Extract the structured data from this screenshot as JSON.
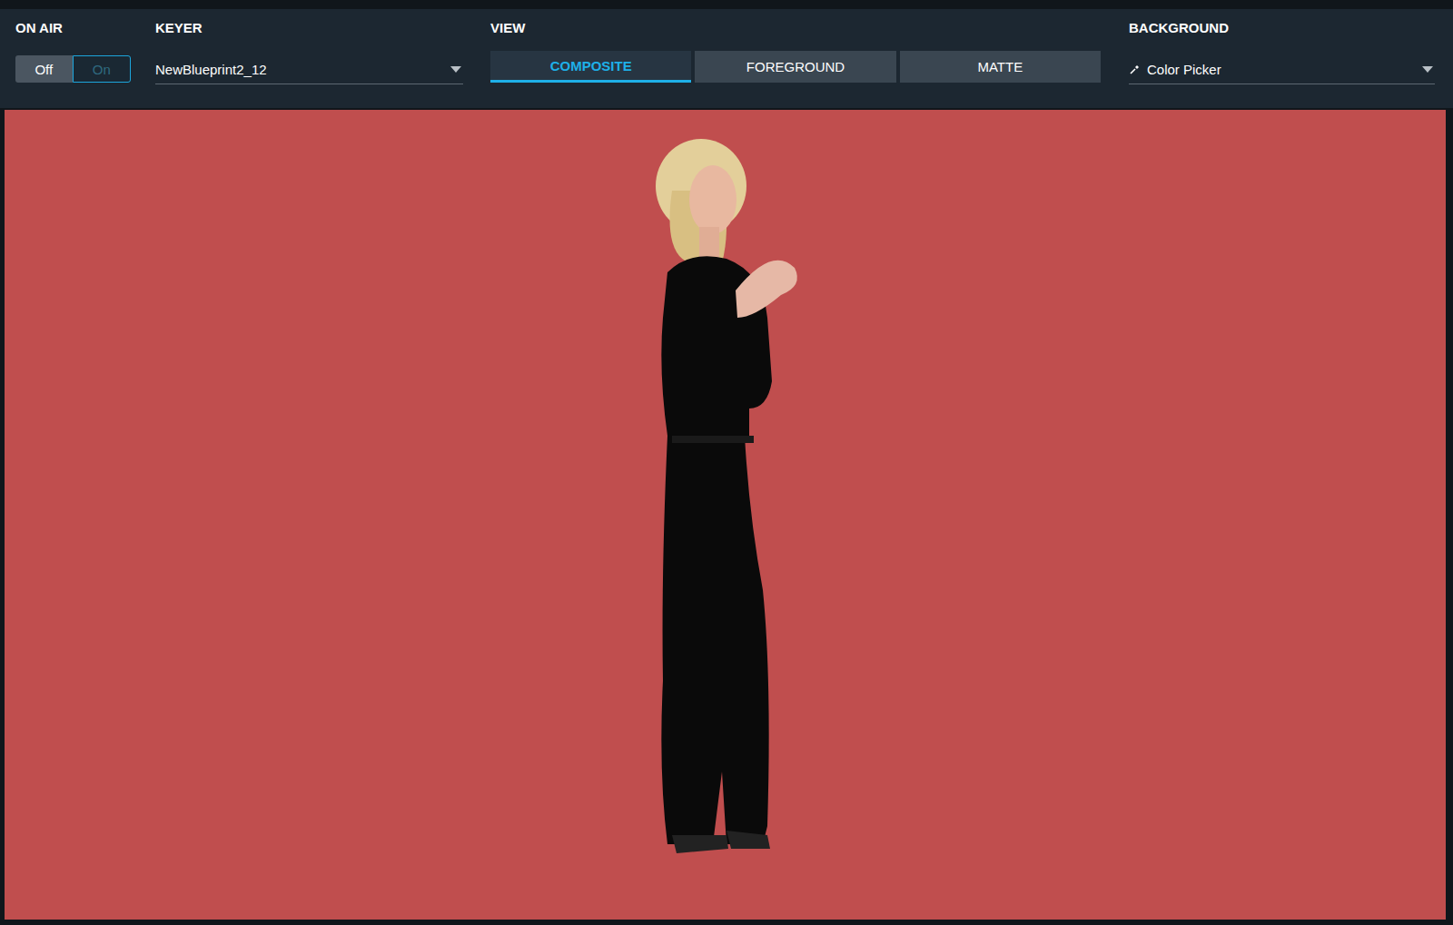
{
  "on_air": {
    "label": "ON AIR",
    "options": [
      {
        "label": "Off",
        "selected": true
      },
      {
        "label": "On",
        "selected": false
      }
    ]
  },
  "keyer": {
    "label": "KEYER",
    "value": "NewBlueprint2_12"
  },
  "view": {
    "label": "VIEW",
    "tabs": [
      {
        "label": "COMPOSITE",
        "selected": true
      },
      {
        "label": "FOREGROUND",
        "selected": false
      },
      {
        "label": "MATTE",
        "selected": false
      }
    ]
  },
  "background": {
    "label": "BACKGROUND",
    "value": "Color Picker",
    "color": "#c04e4e"
  }
}
